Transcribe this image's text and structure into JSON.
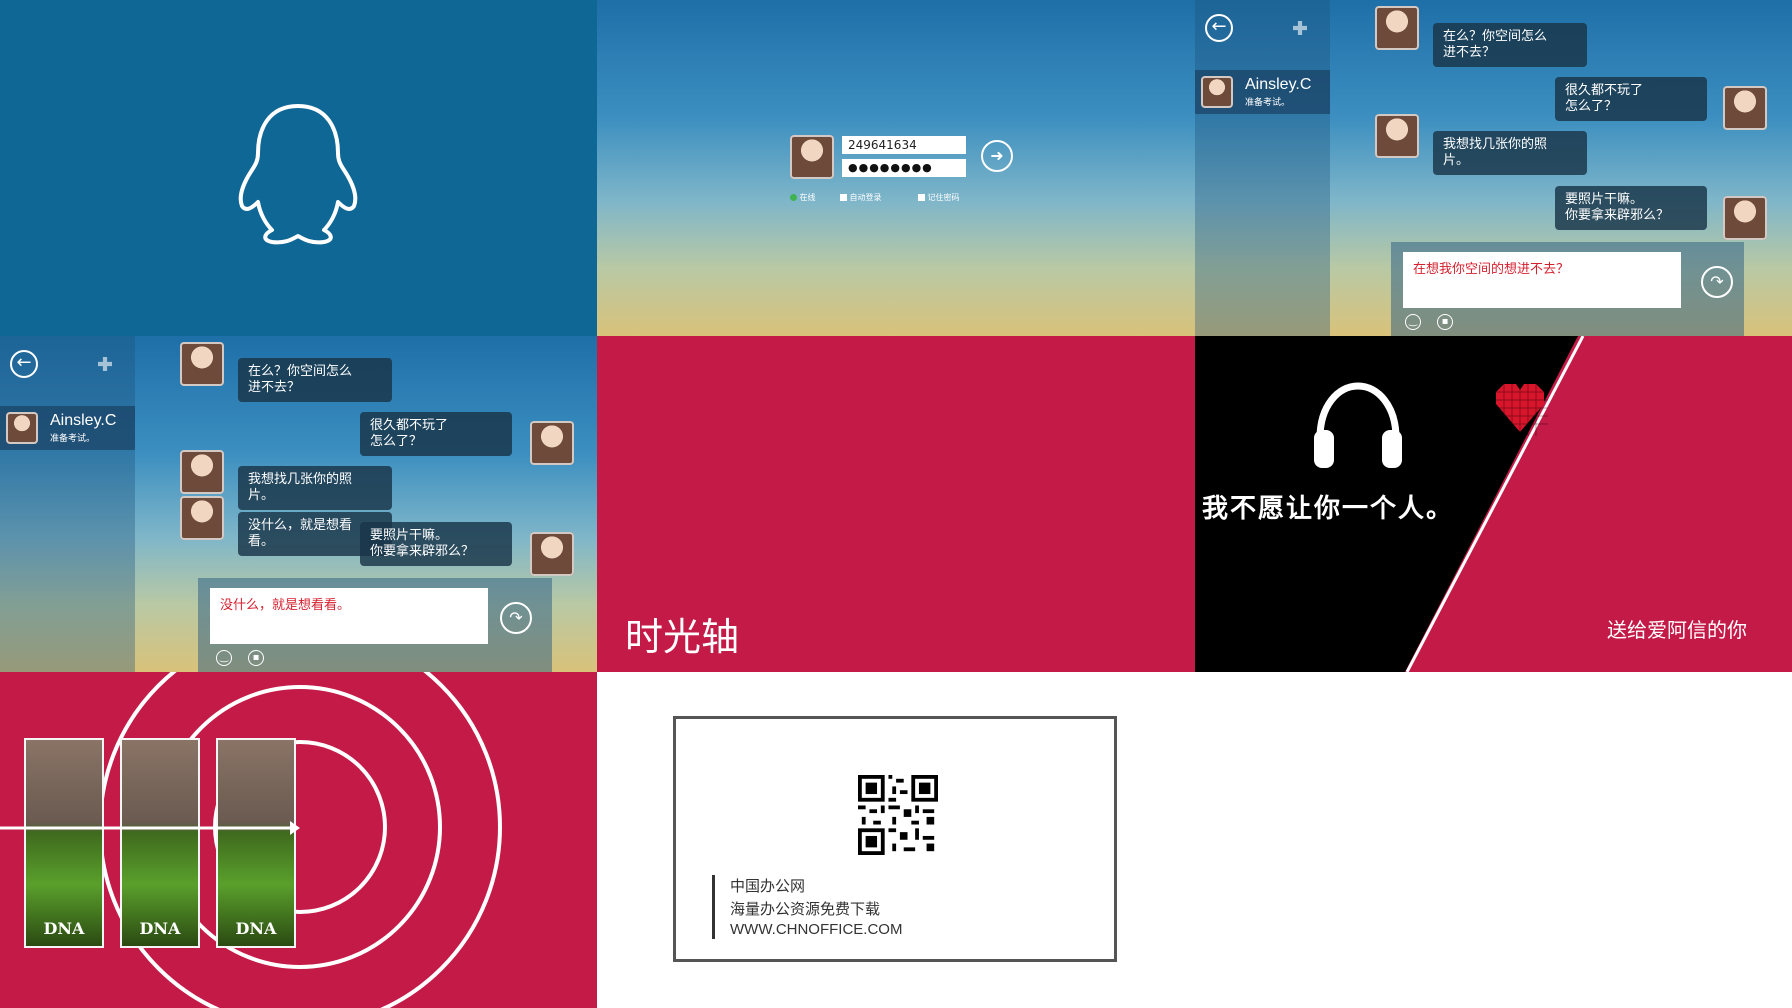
{
  "login": {
    "qq_number": "249641634",
    "password_mask": "●●●●●●●●",
    "options": [
      "在线",
      "自动登录",
      "记住密码"
    ]
  },
  "chat_a": {
    "contact_name": "Ainsley.C",
    "contact_status": "准备考试。",
    "messages": [
      {
        "side": "left",
        "text": "在么？你空间怎么\n进不去？"
      },
      {
        "side": "right",
        "text": "很久都不玩了\n怎么了？"
      },
      {
        "side": "left",
        "text": "我想找几张你的照\n片。"
      },
      {
        "side": "right",
        "text": "要照片干嘛。\n你要拿来辟邪么？"
      }
    ],
    "input_text": "在想我你空间的想进不去？"
  },
  "chat_b": {
    "contact_name": "Ainsley.C",
    "contact_status": "准备考试。",
    "messages": [
      {
        "side": "left",
        "text": "在么？你空间怎么\n进不去？"
      },
      {
        "side": "right",
        "text": "很久都不玩了\n怎么了？"
      },
      {
        "side": "left",
        "text": "我想找几张你的照\n片。"
      },
      {
        "side": "left",
        "text": "没什么，就是想看\n看。"
      },
      {
        "side": "right",
        "text": "要照片干嘛。\n你要拿来辟邪么？"
      }
    ],
    "input_text": "没什么，就是想看看。"
  },
  "timeline": {
    "title": "时光轴"
  },
  "music": {
    "slogan": "我不愿让你一个人。",
    "dedication": "送给爱阿信的你"
  },
  "posters": {
    "title": "DNA"
  },
  "card": {
    "line1": "中国办公网",
    "line2": "海量办公资源免费下载",
    "line3": "WWW.CHNOFFICE.COM"
  },
  "colors": {
    "qq_blue": "#0f6796",
    "crimson": "#c41a47"
  }
}
